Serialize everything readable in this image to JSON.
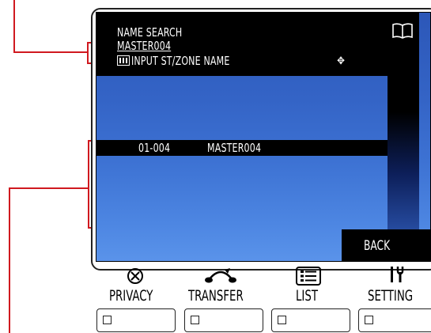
{
  "screen": {
    "title": "NAME SEARCH",
    "entry_value": "MASTER004",
    "hint": "INPUT ST/ZONE NAME",
    "result": {
      "number": "01-004",
      "name": "MASTER004"
    },
    "back_label": "BACK"
  },
  "soft_keys": [
    {
      "label": "PRIVACY",
      "icon": "privacy-icon"
    },
    {
      "label": "TRANSFER",
      "icon": "transfer-icon"
    },
    {
      "label": "LIST",
      "icon": "list-icon"
    },
    {
      "label": "SETTING",
      "icon": "setting-icon"
    }
  ],
  "colors": {
    "callout": "#d0191f",
    "screen_blue": "#3464c6"
  }
}
